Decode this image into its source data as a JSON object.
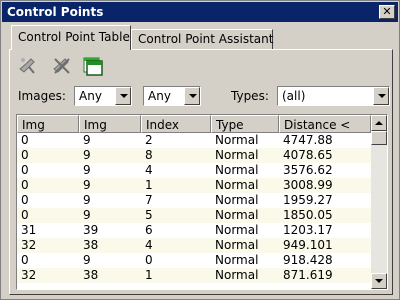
{
  "window": {
    "title": "Control Points"
  },
  "tabs": [
    {
      "label": "Control Point Table",
      "active": true
    },
    {
      "label": "Control Point Assistant",
      "active": false
    }
  ],
  "toolbar": {
    "icons": [
      "add-point-icon",
      "delete-point-icon",
      "new-window-icon"
    ]
  },
  "filters": {
    "images_label": "Images:",
    "image1_value": "Any",
    "image2_value": "Any",
    "types_label": "Types:",
    "types_value": "(all)"
  },
  "table": {
    "columns": [
      "Img",
      "Img",
      "Index",
      "Type",
      "Distance <"
    ],
    "rows": [
      [
        "0",
        "9",
        "2",
        "Normal",
        "4747.88"
      ],
      [
        "0",
        "9",
        "8",
        "Normal",
        "4078.65"
      ],
      [
        "0",
        "9",
        "4",
        "Normal",
        "3576.62"
      ],
      [
        "0",
        "9",
        "1",
        "Normal",
        "3008.99"
      ],
      [
        "0",
        "9",
        "7",
        "Normal",
        "1959.27"
      ],
      [
        "0",
        "9",
        "5",
        "Normal",
        "1850.05"
      ],
      [
        "31",
        "39",
        "6",
        "Normal",
        "1203.17"
      ],
      [
        "32",
        "38",
        "4",
        "Normal",
        "949.101"
      ],
      [
        "0",
        "9",
        "0",
        "Normal",
        "918.428"
      ],
      [
        "32",
        "38",
        "1",
        "Normal",
        "871.619"
      ]
    ]
  },
  "colors": {
    "titlebar": "#0a246a",
    "row_alt": "#fbf9e9",
    "face": "#d4d0c8"
  }
}
